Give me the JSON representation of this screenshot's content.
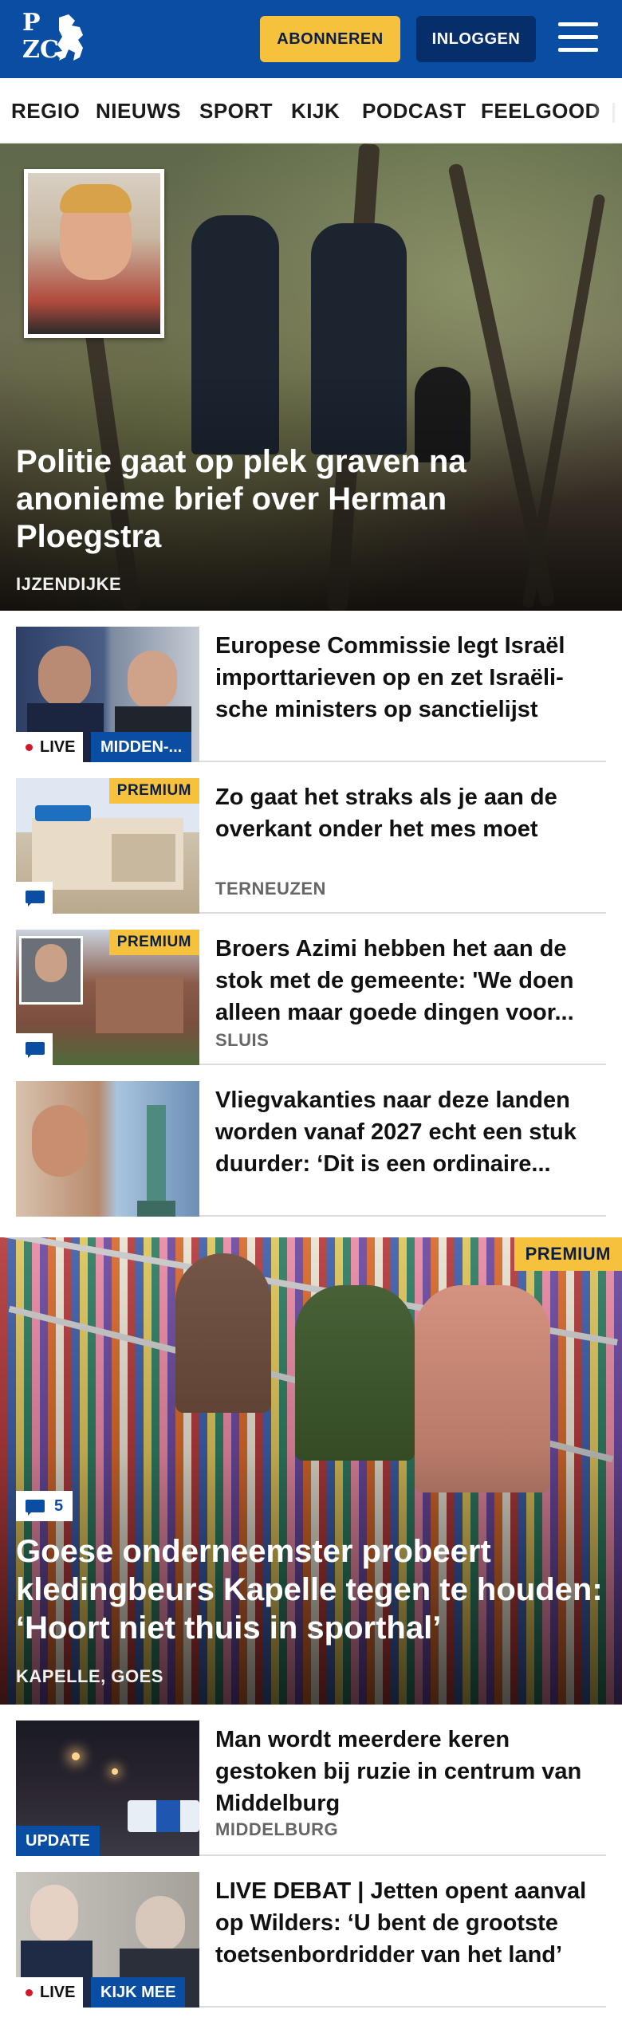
{
  "header": {
    "logo_letters": [
      "P",
      "Z",
      "C"
    ],
    "logo_alt": "PZC",
    "subscribe_label": "ABONNEREN",
    "login_label": "INLOGGEN",
    "colors": {
      "brand": "#0a4ea3",
      "accent": "#f6c13c"
    },
    "menu_icon": "hamburger-menu-icon"
  },
  "nav": {
    "items": [
      "REGIO",
      "NIEUWS",
      "SPORT",
      "KIJK",
      "PODCAST",
      "FEELGOOD"
    ]
  },
  "hero": {
    "title": "Politie gaat op plek graven na anonieme brief over Herman Ploegstra",
    "tag": "IJZENDIJKE"
  },
  "articles": [
    {
      "title": "Europese Commissie legt Israël importtarieven op en zet Israëli-sche ministers op sanctielijst",
      "live_label": "LIVE",
      "category_label": "MIDDEN-..."
    },
    {
      "title": "Zo gaat het straks als je aan de overkant onder het mes moet",
      "tag": "TERNEUZEN",
      "premium_label": "PREMIUM",
      "comment_icon": "comment-icon"
    },
    {
      "title": "Broers Azimi hebben het aan de stok met de gemeente: 'We doen alleen maar goede dingen voor...",
      "tag": "SLUIS",
      "premium_label": "PREMIUM",
      "comment_icon": "comment-icon"
    },
    {
      "title": "Vliegvakanties naar deze landen worden vanaf 2027 echt een stuk duurder: ‘Dit is een ordinaire..."
    }
  ],
  "feature": {
    "premium_label": "PREMIUM",
    "comment_count": "5",
    "title": "Goese onderneemster probeert kledingbeurs Kapelle tegen te houden: ‘Hoort niet thuis in sporthal’",
    "tag": "KAPELLE, GOES"
  },
  "articles2": [
    {
      "title": "Man wordt meerdere keren gestoken bij ruzie in centrum van Middelburg",
      "tag": "MIDDELBURG",
      "badge_label": "UPDATE"
    },
    {
      "title": "LIVE DEBAT | Jetten opent aanval op Wilders: ‘U bent de grootste toetsenbordridder van het land’",
      "live_label": "LIVE",
      "badge_label": "KIJK MEE"
    }
  ]
}
